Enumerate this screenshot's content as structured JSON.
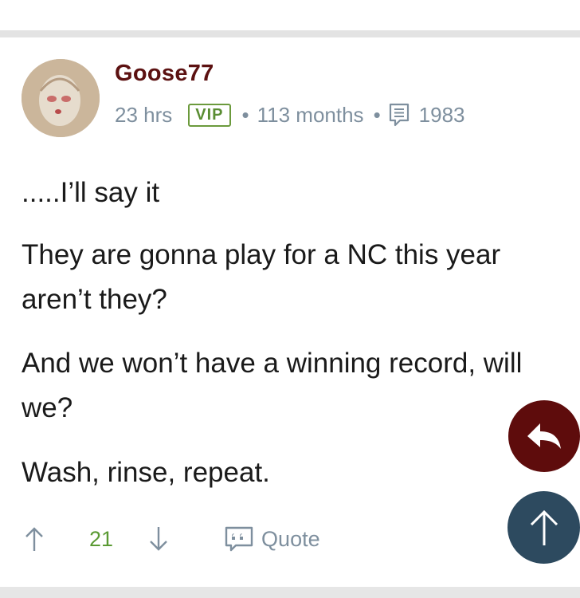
{
  "post": {
    "username": "Goose77",
    "time": "23 hrs",
    "badge": "VIP",
    "separator": "•",
    "membership": "113 months",
    "post_count": "1983",
    "paragraphs": [
      ".....I’ll say it",
      "They are gonna play for a NC this year aren’t they?",
      "And we won’t have a winning record, will we?",
      "Wash, rinse, repeat."
    ]
  },
  "actions": {
    "score": "21",
    "quote_label": "Quote"
  },
  "icons": {
    "avatar": "user-avatar",
    "posts": "posts-icon",
    "upvote": "arrow-up-icon",
    "downvote": "arrow-down-icon",
    "quote": "quote-icon",
    "reply": "reply-icon",
    "scroll_top": "arrow-up-icon"
  },
  "colors": {
    "username": "#5c1111",
    "vip": "#5a8d33",
    "score": "#5a9a33",
    "reply_fab": "#5e0c0c",
    "scroll_top_fab": "#2d4a5f"
  }
}
